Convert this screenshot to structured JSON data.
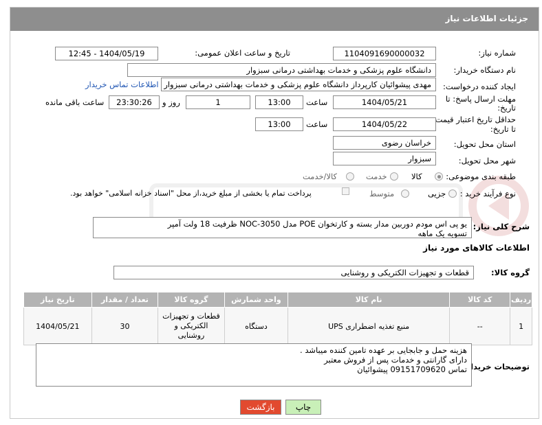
{
  "header": {
    "title": "جزئیات اطلاعات نیاز"
  },
  "fields": {
    "need_number_label": "شماره نیاز:",
    "need_number": "1104091690000032",
    "announce_label": "تاریخ و ساعت اعلان عمومی:",
    "announce_value": "1404/05/19 - 12:45",
    "buyer_label": "نام دستگاه خریدار:",
    "buyer_value": "دانشگاه علوم پزشکی و خدمات بهداشتی  درمانی سبزوار",
    "creator_label": "ایجاد کننده درخواست:",
    "creator_value": "مهدی پیشوائیان کارپرداز دانشگاه علوم پزشکی و خدمات بهداشتی  درمانی سبزوار",
    "contact_link": "اطلاعات تماس خریدار",
    "deadline_label_1": "مهلت ارسال پاسخ: تا",
    "deadline_label_2": "تاریخ:",
    "deadline_date": "1404/05/21",
    "time_label": "ساعت",
    "deadline_time": "13:00",
    "days_value": "1",
    "days_label": "روز و",
    "remaining_time": "23:30:26",
    "remaining_label": "ساعت باقی مانده",
    "price_label_1": "حداقل تاریخ اعتبار قیمت:",
    "price_label_2": "تا تاریخ:",
    "price_date": "1404/05/22",
    "price_time": "13:00",
    "province_label": "استان محل تحویل:",
    "province_value": "خراسان رضوی",
    "city_label": "شهر محل تحویل:",
    "city_value": "سبزوار",
    "category_label": "طبقه بندی موضوعی:",
    "category_options": [
      "کالا",
      "خدمت",
      "کالا/خدمت"
    ],
    "process_label": "نوع فرآیند خرید :",
    "process_options": [
      "جزیی",
      "متوسط"
    ],
    "payment_note": "پرداخت تمام یا بخشی از مبلغ خرید،از محل \"اسناد خزانه اسلامی\" خواهد بود."
  },
  "description": {
    "label": "شرح کلی نیاز:",
    "line1": "یو پی اس مودم دوربین مدار بسته و کارتخوان POE مدل NOC-3050 ظرفیت 18 ولت آمپر",
    "line2": "تسویه یک ماهه"
  },
  "goods": {
    "section_title": "اطلاعات کالاهای مورد نیاز",
    "group_label": "گروه کالا:",
    "group_value": "قطعات و تجهیزات الکتریکی و روشنایی",
    "columns": [
      "ردیف",
      "کد کالا",
      "نام کالا",
      "واحد شمارش",
      "گروه کالا",
      "تعداد / مقدار",
      "تاریخ نیاز"
    ],
    "rows": [
      {
        "row": "1",
        "code": "--",
        "name": "منبع تغذیه اضطراری UPS",
        "unit": "دستگاه",
        "group_l1": "قطعات و تجهیزات",
        "group_l2": "الکتریکی و",
        "group_l3": "روشنایی",
        "qty": "30",
        "date": "1404/05/21"
      }
    ]
  },
  "buyer_notes": {
    "label": "توضیحات خریدار:",
    "line1": "هزینه حمل و جابجایی بر عهده تامین کننده میباشد .",
    "line2": "دارای گارانتی و خدمات پس از فروش معتبر",
    "line3": "تماس 09151709620 پیشوائیان"
  },
  "buttons": {
    "print": "چاپ",
    "back": "بازگشت"
  },
  "colors": {
    "header": "#8e8e8e",
    "back_button": "#e24a2f",
    "print_button": "#c9f0b8",
    "table_header": "#b3b3b3",
    "link": "#1f55b3"
  }
}
